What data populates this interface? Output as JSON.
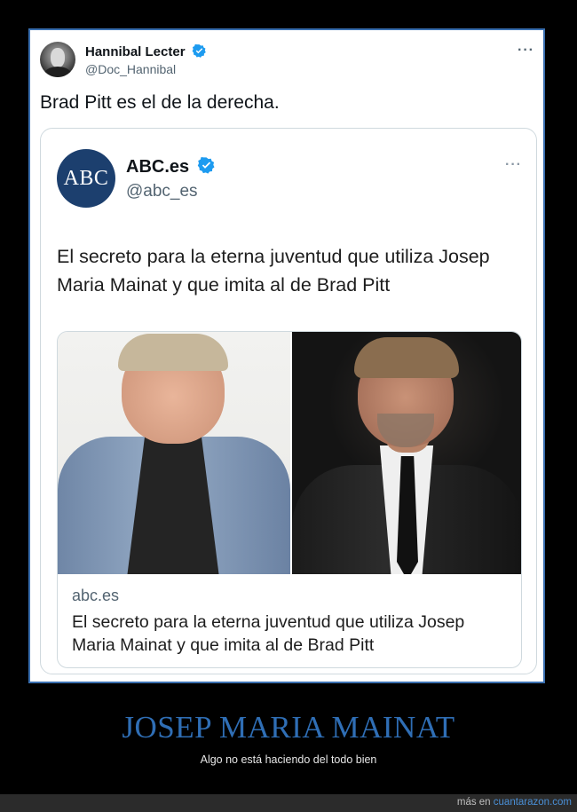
{
  "tweet": {
    "author_name": "Hannibal Lecter",
    "author_handle": "@Doc_Hannibal",
    "text": "Brad Pitt es el de la derecha.",
    "more": "···"
  },
  "quote": {
    "logo_text": "ABC",
    "name": "ABC.es",
    "handle": "@abc_es",
    "more": "···",
    "text": "El secreto para la eterna juventud que utiliza Josep Maria Mainat y que imita al de Brad Pitt",
    "link": {
      "domain": "abc.es",
      "title": "El secreto para la eterna juventud que utiliza Josep Maria Mainat y que imita al de Brad Pitt"
    }
  },
  "meme": {
    "headline": "JOSEP MARIA MAINAT",
    "subline": "Algo no está haciendo del todo bien"
  },
  "footer": {
    "prefix": "más en ",
    "site": "cuantarazon.com"
  },
  "colors": {
    "verified": "#1d9bf0",
    "headline": "#2f6eb5",
    "abc_logo": "#1c3f6e"
  },
  "icons": [
    "verified-badge-icon",
    "more-options-icon"
  ]
}
